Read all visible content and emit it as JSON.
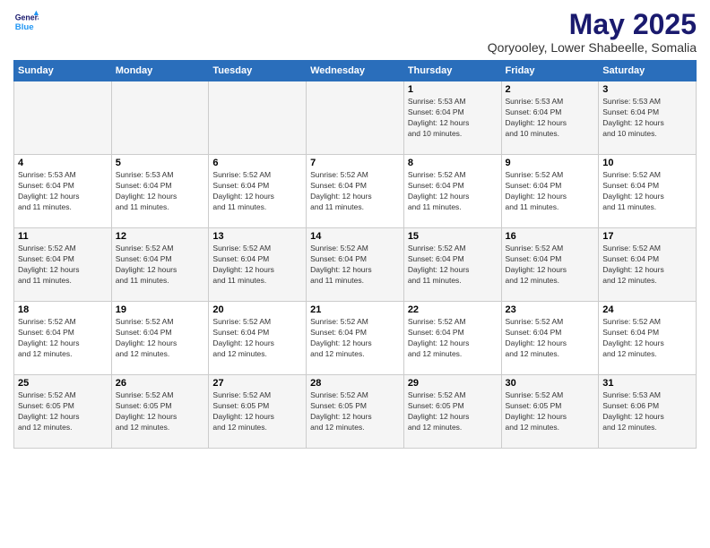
{
  "logo": {
    "line1": "General",
    "line2": "Blue"
  },
  "title": "May 2025",
  "subtitle": "Qoryooley, Lower Shabeelle, Somalia",
  "days_of_week": [
    "Sunday",
    "Monday",
    "Tuesday",
    "Wednesday",
    "Thursday",
    "Friday",
    "Saturday"
  ],
  "weeks": [
    [
      {
        "day": "",
        "info": ""
      },
      {
        "day": "",
        "info": ""
      },
      {
        "day": "",
        "info": ""
      },
      {
        "day": "",
        "info": ""
      },
      {
        "day": "1",
        "info": "Sunrise: 5:53 AM\nSunset: 6:04 PM\nDaylight: 12 hours\nand 10 minutes."
      },
      {
        "day": "2",
        "info": "Sunrise: 5:53 AM\nSunset: 6:04 PM\nDaylight: 12 hours\nand 10 minutes."
      },
      {
        "day": "3",
        "info": "Sunrise: 5:53 AM\nSunset: 6:04 PM\nDaylight: 12 hours\nand 10 minutes."
      }
    ],
    [
      {
        "day": "4",
        "info": "Sunrise: 5:53 AM\nSunset: 6:04 PM\nDaylight: 12 hours\nand 11 minutes."
      },
      {
        "day": "5",
        "info": "Sunrise: 5:53 AM\nSunset: 6:04 PM\nDaylight: 12 hours\nand 11 minutes."
      },
      {
        "day": "6",
        "info": "Sunrise: 5:52 AM\nSunset: 6:04 PM\nDaylight: 12 hours\nand 11 minutes."
      },
      {
        "day": "7",
        "info": "Sunrise: 5:52 AM\nSunset: 6:04 PM\nDaylight: 12 hours\nand 11 minutes."
      },
      {
        "day": "8",
        "info": "Sunrise: 5:52 AM\nSunset: 6:04 PM\nDaylight: 12 hours\nand 11 minutes."
      },
      {
        "day": "9",
        "info": "Sunrise: 5:52 AM\nSunset: 6:04 PM\nDaylight: 12 hours\nand 11 minutes."
      },
      {
        "day": "10",
        "info": "Sunrise: 5:52 AM\nSunset: 6:04 PM\nDaylight: 12 hours\nand 11 minutes."
      }
    ],
    [
      {
        "day": "11",
        "info": "Sunrise: 5:52 AM\nSunset: 6:04 PM\nDaylight: 12 hours\nand 11 minutes."
      },
      {
        "day": "12",
        "info": "Sunrise: 5:52 AM\nSunset: 6:04 PM\nDaylight: 12 hours\nand 11 minutes."
      },
      {
        "day": "13",
        "info": "Sunrise: 5:52 AM\nSunset: 6:04 PM\nDaylight: 12 hours\nand 11 minutes."
      },
      {
        "day": "14",
        "info": "Sunrise: 5:52 AM\nSunset: 6:04 PM\nDaylight: 12 hours\nand 11 minutes."
      },
      {
        "day": "15",
        "info": "Sunrise: 5:52 AM\nSunset: 6:04 PM\nDaylight: 12 hours\nand 11 minutes."
      },
      {
        "day": "16",
        "info": "Sunrise: 5:52 AM\nSunset: 6:04 PM\nDaylight: 12 hours\nand 12 minutes."
      },
      {
        "day": "17",
        "info": "Sunrise: 5:52 AM\nSunset: 6:04 PM\nDaylight: 12 hours\nand 12 minutes."
      }
    ],
    [
      {
        "day": "18",
        "info": "Sunrise: 5:52 AM\nSunset: 6:04 PM\nDaylight: 12 hours\nand 12 minutes."
      },
      {
        "day": "19",
        "info": "Sunrise: 5:52 AM\nSunset: 6:04 PM\nDaylight: 12 hours\nand 12 minutes."
      },
      {
        "day": "20",
        "info": "Sunrise: 5:52 AM\nSunset: 6:04 PM\nDaylight: 12 hours\nand 12 minutes."
      },
      {
        "day": "21",
        "info": "Sunrise: 5:52 AM\nSunset: 6:04 PM\nDaylight: 12 hours\nand 12 minutes."
      },
      {
        "day": "22",
        "info": "Sunrise: 5:52 AM\nSunset: 6:04 PM\nDaylight: 12 hours\nand 12 minutes."
      },
      {
        "day": "23",
        "info": "Sunrise: 5:52 AM\nSunset: 6:04 PM\nDaylight: 12 hours\nand 12 minutes."
      },
      {
        "day": "24",
        "info": "Sunrise: 5:52 AM\nSunset: 6:04 PM\nDaylight: 12 hours\nand 12 minutes."
      }
    ],
    [
      {
        "day": "25",
        "info": "Sunrise: 5:52 AM\nSunset: 6:05 PM\nDaylight: 12 hours\nand 12 minutes."
      },
      {
        "day": "26",
        "info": "Sunrise: 5:52 AM\nSunset: 6:05 PM\nDaylight: 12 hours\nand 12 minutes."
      },
      {
        "day": "27",
        "info": "Sunrise: 5:52 AM\nSunset: 6:05 PM\nDaylight: 12 hours\nand 12 minutes."
      },
      {
        "day": "28",
        "info": "Sunrise: 5:52 AM\nSunset: 6:05 PM\nDaylight: 12 hours\nand 12 minutes."
      },
      {
        "day": "29",
        "info": "Sunrise: 5:52 AM\nSunset: 6:05 PM\nDaylight: 12 hours\nand 12 minutes."
      },
      {
        "day": "30",
        "info": "Sunrise: 5:52 AM\nSunset: 6:05 PM\nDaylight: 12 hours\nand 12 minutes."
      },
      {
        "day": "31",
        "info": "Sunrise: 5:53 AM\nSunset: 6:06 PM\nDaylight: 12 hours\nand 12 minutes."
      }
    ]
  ]
}
